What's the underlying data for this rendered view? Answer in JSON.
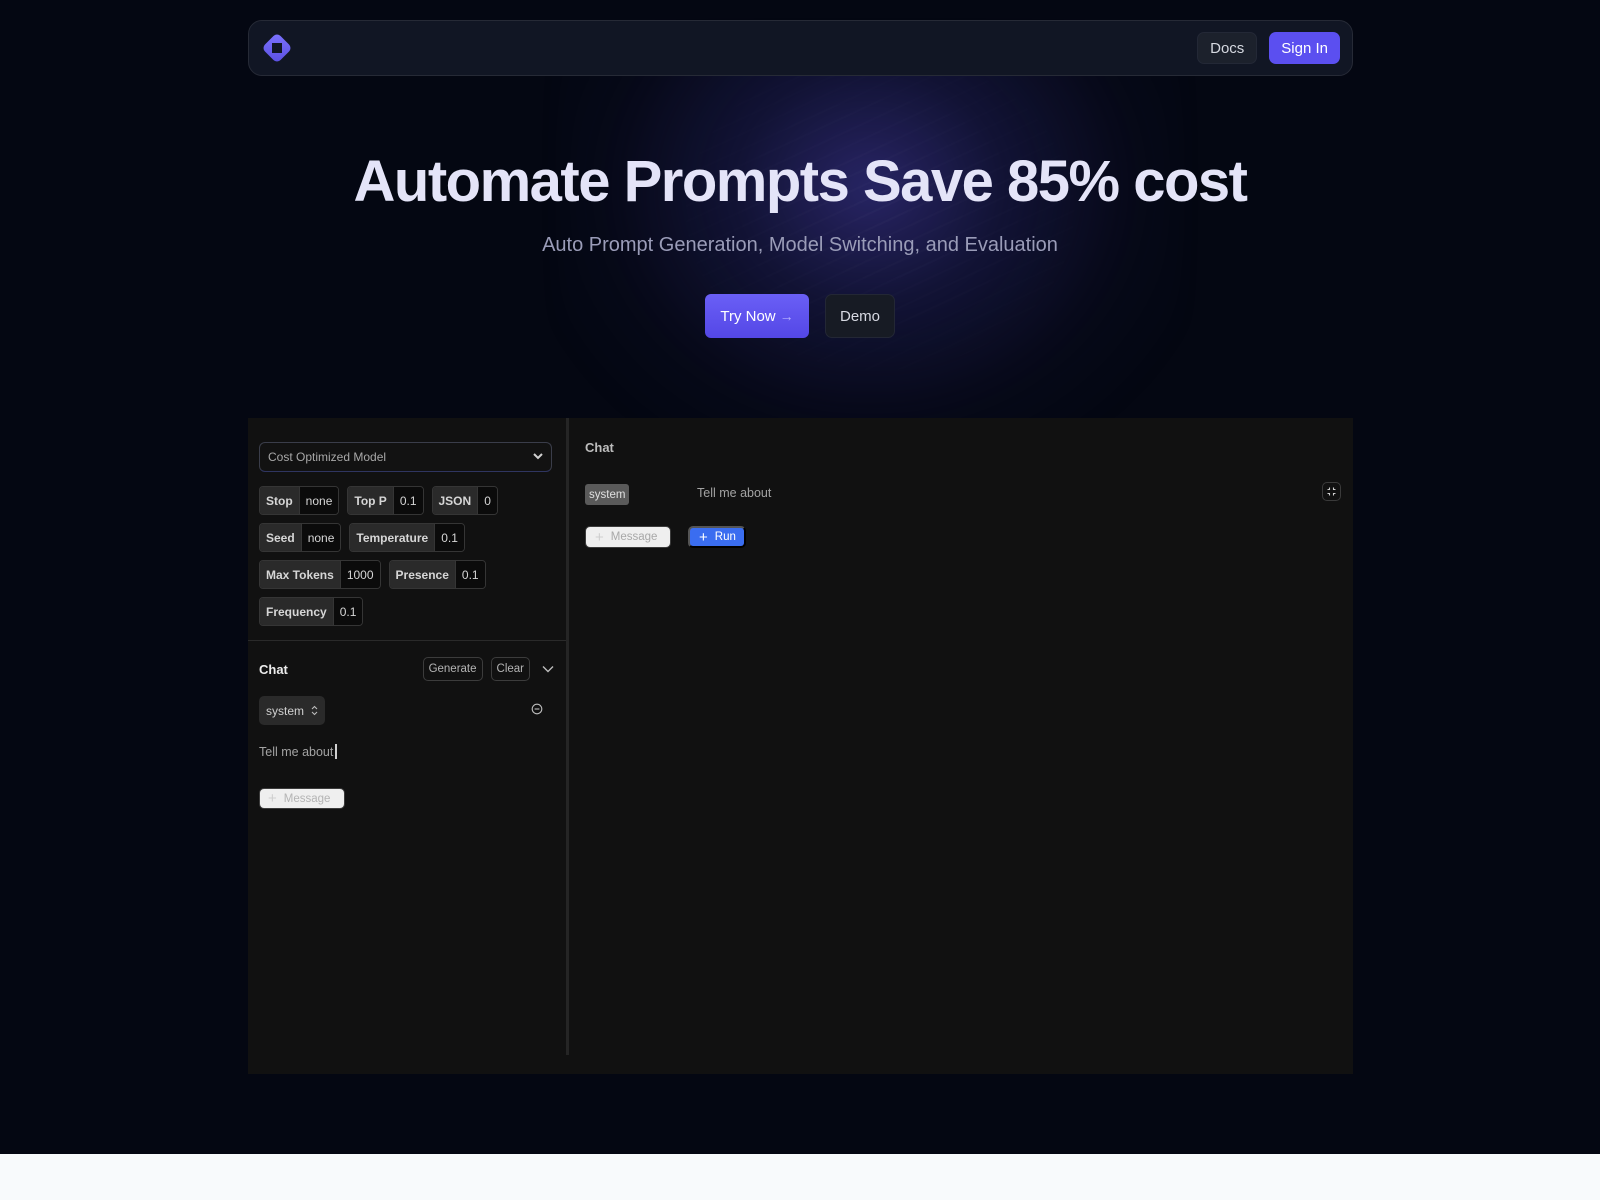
{
  "nav": {
    "logo": "logo-icon",
    "docs_label": "Docs",
    "signin_label": "Sign In"
  },
  "hero": {
    "title": "Automate Prompts Save 85% cost",
    "subtitle": "Auto Prompt Generation, Model Switching, and Evaluation",
    "try_label": "Try Now",
    "try_icon": "→",
    "demo_label": "Demo"
  },
  "playground": {
    "model_select": {
      "value": "Cost Optimized Model",
      "icon": "chevron-down-icon"
    },
    "params": [
      [
        {
          "label": "Stop",
          "value": "none"
        },
        {
          "label": "Top P",
          "value": "0.1"
        },
        {
          "label": "JSON",
          "value": "0"
        }
      ],
      [
        {
          "label": "Seed",
          "value": "none"
        },
        {
          "label": "Temperature",
          "value": "0.1"
        }
      ],
      [
        {
          "label": "Max Tokens",
          "value": "1000"
        },
        {
          "label": "Presence",
          "value": "0.1"
        }
      ],
      [
        {
          "label": "Frequency",
          "value": "0.1"
        }
      ]
    ],
    "left_chat": {
      "title": "Chat",
      "generate_label": "Generate",
      "clear_label": "Clear",
      "role": "system",
      "message": "Tell me about",
      "add_message_label": "Message"
    },
    "right_chat": {
      "title": "Chat",
      "role": "system",
      "message": "Tell me about",
      "add_message_label": "Message",
      "run_label": "Run"
    }
  },
  "colors": {
    "background": "#040712",
    "accent": "#5b4ff0",
    "run_blue": "#3a6df0",
    "panel": "#111111"
  }
}
